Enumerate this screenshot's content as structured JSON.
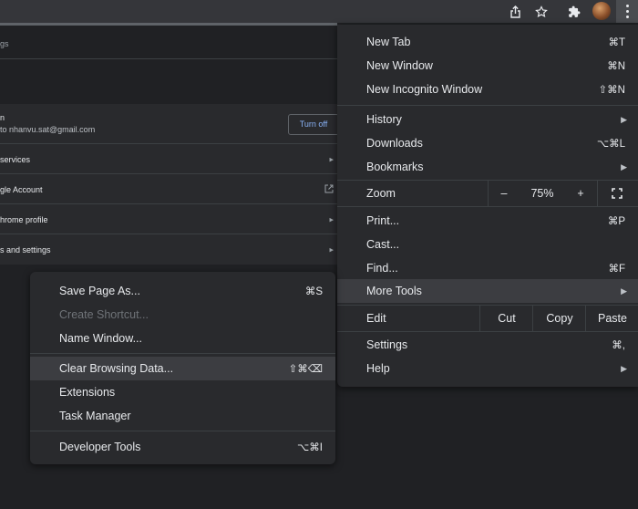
{
  "settings": {
    "search_placeholder": "gs",
    "account_title": "n",
    "account_email": "to nhanvu.sat@gmail.com",
    "turn_off_label": "Turn off",
    "rows": [
      {
        "label": "services"
      },
      {
        "label": "gle Account"
      },
      {
        "label": "hrome profile"
      },
      {
        "label": "s and settings"
      }
    ]
  },
  "main_menu": {
    "new_tab": {
      "label": "New Tab",
      "shortcut": "⌘T"
    },
    "new_window": {
      "label": "New Window",
      "shortcut": "⌘N"
    },
    "new_incognito": {
      "label": "New Incognito Window",
      "shortcut": "⇧⌘N"
    },
    "history": {
      "label": "History"
    },
    "downloads": {
      "label": "Downloads",
      "shortcut": "⌥⌘L"
    },
    "bookmarks": {
      "label": "Bookmarks"
    },
    "zoom": {
      "label": "Zoom",
      "minus": "–",
      "value": "75%",
      "plus": "+"
    },
    "print": {
      "label": "Print...",
      "shortcut": "⌘P"
    },
    "cast": {
      "label": "Cast..."
    },
    "find": {
      "label": "Find...",
      "shortcut": "⌘F"
    },
    "more_tools": {
      "label": "More Tools"
    },
    "edit": {
      "label": "Edit",
      "cut": "Cut",
      "copy": "Copy",
      "paste": "Paste"
    },
    "settings": {
      "label": "Settings",
      "shortcut": "⌘,"
    },
    "help": {
      "label": "Help"
    }
  },
  "sub_menu": {
    "save_page": {
      "label": "Save Page As...",
      "shortcut": "⌘S"
    },
    "create_shortcut": {
      "label": "Create Shortcut..."
    },
    "name_window": {
      "label": "Name Window..."
    },
    "clear_browsing": {
      "label": "Clear Browsing Data...",
      "shortcut": "⇧⌘⌫"
    },
    "extensions": {
      "label": "Extensions"
    },
    "task_manager": {
      "label": "Task Manager"
    },
    "developer_tools": {
      "label": "Developer Tools",
      "shortcut": "⌥⌘I"
    }
  },
  "toolbar_icons": [
    "share-icon",
    "star-icon",
    "puzzle-extension-icon",
    "avatar",
    "kebab-menu-icon"
  ]
}
